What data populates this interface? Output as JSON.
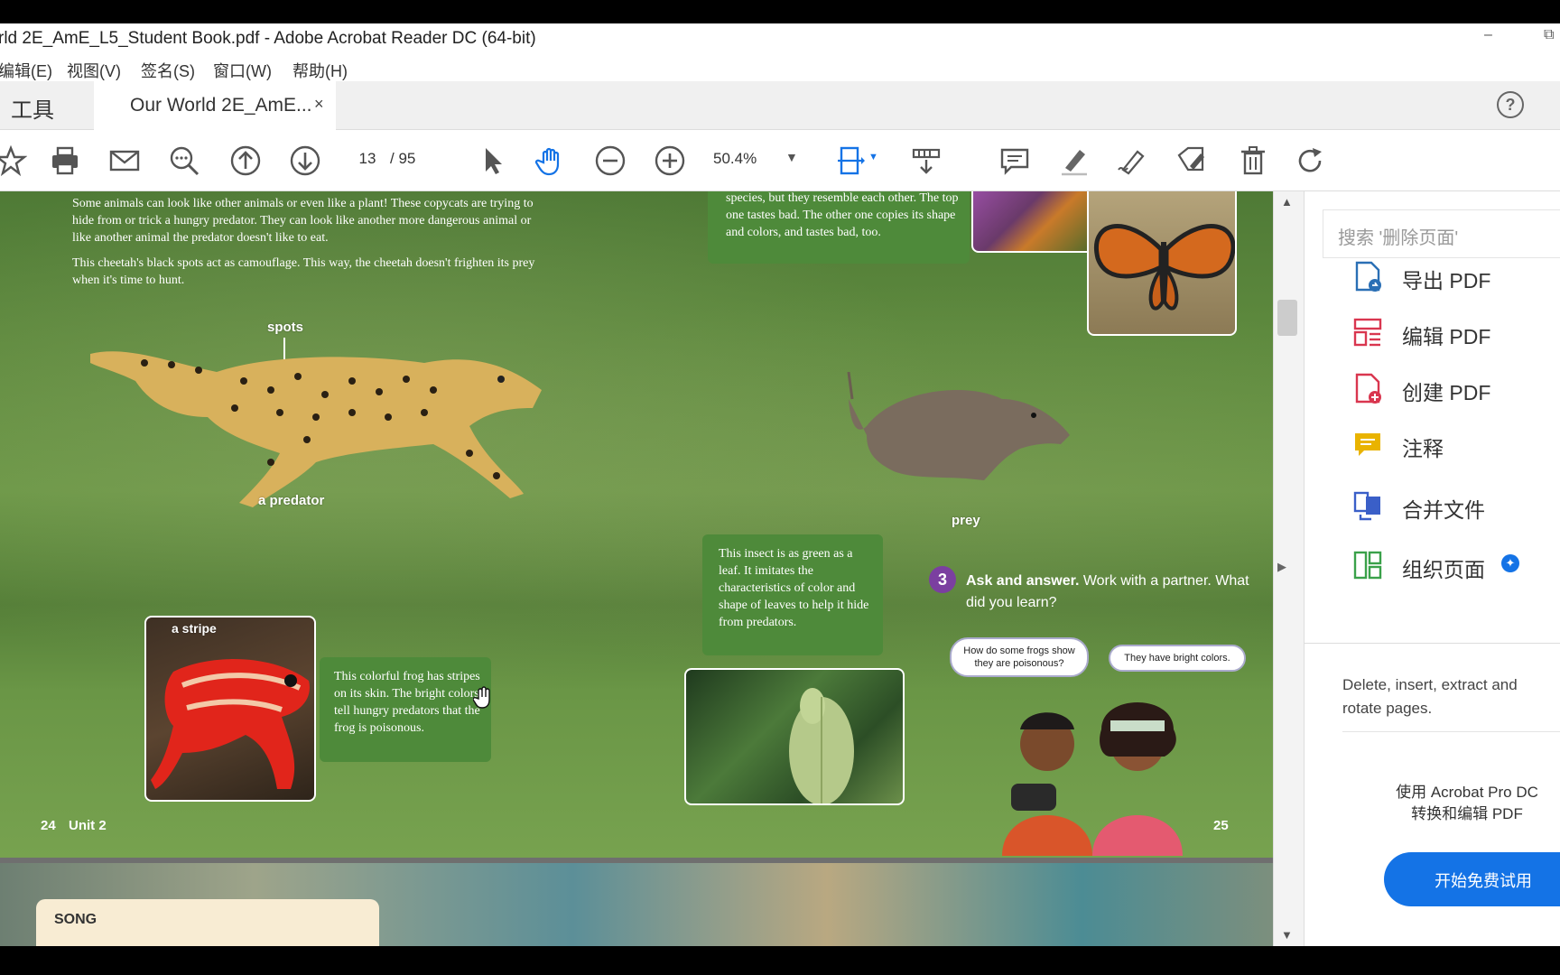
{
  "window": {
    "title": "rld 2E_AmE_L5_Student Book.pdf - Adobe Acrobat Reader DC (64-bit)",
    "minimize": "–",
    "restore": "⧉"
  },
  "menu": [
    "编辑(E)",
    "视图(V)",
    "签名(S)",
    "窗口(W)",
    "帮助(H)"
  ],
  "tabs": {
    "tools": "工具",
    "document": "Our World 2E_AmE...",
    "close": "×"
  },
  "toolbar": {
    "page_current": "13",
    "page_total": "/ 95",
    "zoom": "50.4%"
  },
  "page": {
    "intro_1": "Some animals can look like other animals or even like a plant! These copycats are trying to hide from or trick a hungry predator. They can look like another more dangerous animal or like another animal the predator doesn't like to eat.",
    "intro_2": "This cheetah's black spots act as camouflage. This way, the cheetah doesn't frighten its prey when it's time to hunt.",
    "butterfly_text": "species, but they resemble each other. The top one tastes bad. The other one copies its shape and colors, and tastes bad, too.",
    "label_spots": "spots",
    "label_predator": "a predator",
    "label_prey": "prey",
    "label_stripe": "a stripe",
    "frog_text": "This colorful frog has stripes on its skin. The bright colors tell hungry predators that the frog is poisonous.",
    "insect_text": "This insect is as green as a leaf. It imitates the characteristics of color and shape of leaves to help it hide from predators.",
    "activity_number": "3",
    "activity_title": "Ask and answer.",
    "activity_text": "Work with a partner. What did you learn?",
    "bubble_1": "How do some frogs show they are poisonous?",
    "bubble_2": "They have bright colors.",
    "left_page_no": "24",
    "left_unit": "Unit 2",
    "right_page_no": "25",
    "next_page_heading": "SONG"
  },
  "right_panel": {
    "search_placeholder": "搜索 '删除页面'",
    "items": [
      {
        "label": "导出 PDF",
        "icon": "export-pdf-icon",
        "color": "#2a6fb5"
      },
      {
        "label": "编辑 PDF",
        "icon": "edit-pdf-icon",
        "color": "#d9364f"
      },
      {
        "label": "创建 PDF",
        "icon": "create-pdf-icon",
        "color": "#d9364f"
      },
      {
        "label": "注释",
        "icon": "comment-icon",
        "color": "#e9b300"
      },
      {
        "label": "合并文件",
        "icon": "combine-files-icon",
        "color": "#3a5fc8"
      },
      {
        "label": "组织页面",
        "icon": "organize-pages-icon",
        "color": "#3aa14a"
      }
    ],
    "description": "Delete, insert, extract and rotate pages.",
    "pro_line_1": "使用 Acrobat Pro DC",
    "pro_line_2": "转换和编辑 PDF",
    "trial_button": "开始免费试用"
  }
}
